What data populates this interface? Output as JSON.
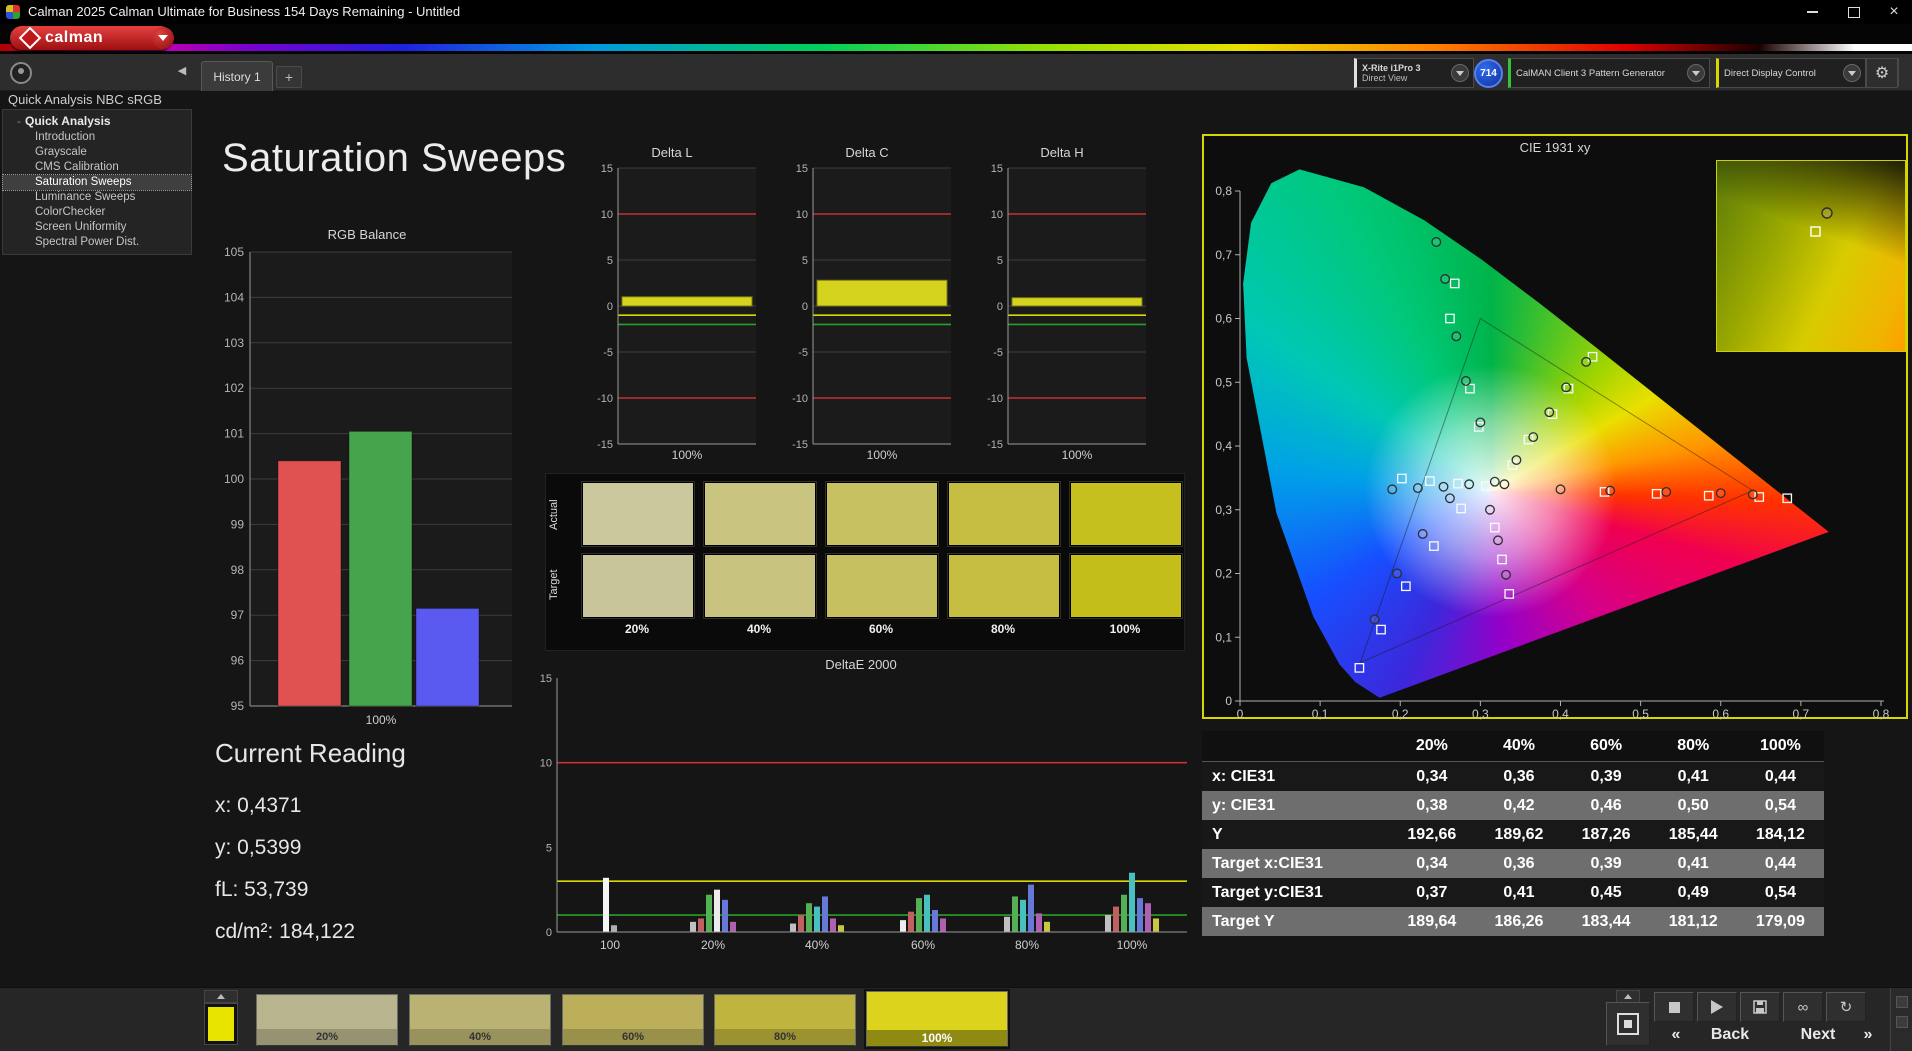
{
  "title_bar": {
    "title": "Calman 2025 Calman Ultimate for Business 154 Days Remaining  - Untitled"
  },
  "brand": {
    "logo_text": "calman"
  },
  "tab_bar": {
    "history_tab": "History 1",
    "add_tab": "+",
    "meter": {
      "line1": "X-Rite i1Pro 3",
      "line2": "Direct View"
    },
    "badge": "714",
    "pattern_generator": "CalMAN Client 3 Pattern Generator",
    "display_control": "Direct Display Control"
  },
  "sidebar": {
    "header": "Quick Analysis NBC sRGB",
    "root": "Quick Analysis",
    "items": [
      {
        "label": "Introduction",
        "selected": false
      },
      {
        "label": "Grayscale",
        "selected": false
      },
      {
        "label": "CMS Calibration",
        "selected": false
      },
      {
        "label": "Saturation Sweeps",
        "selected": true
      },
      {
        "label": "Luminance Sweeps",
        "selected": false
      },
      {
        "label": "ColorChecker",
        "selected": false
      },
      {
        "label": "Screen Uniformity",
        "selected": false
      },
      {
        "label": "Spectral Power Dist.",
        "selected": false
      }
    ]
  },
  "page": {
    "title": "Saturation Sweeps"
  },
  "current_reading": {
    "title": "Current Reading",
    "lines": [
      "x: 0,4371",
      "y: 0,5399",
      "fL: 53,739",
      "cd/m²: 184,122"
    ]
  },
  "colors": {
    "meter_stripe": "#e0e0e0",
    "source_stripe": "#35c435",
    "display_stripe": "#d8d800",
    "cie_border": "#d6d600"
  },
  "chart_data": [
    {
      "id": "rgb_balance",
      "type": "bar",
      "title": "RGB Balance",
      "categories": [
        "Red",
        "Green",
        "Blue"
      ],
      "values": [
        100.4,
        101.05,
        97.15
      ],
      "bar_colors": [
        "#e05252",
        "#46a44c",
        "#5a5af0"
      ],
      "ylim": [
        95,
        105
      ],
      "ytick_step": 1,
      "xlabel": "100%",
      "grid": true
    },
    {
      "id": "delta_l",
      "type": "bar",
      "title": "Delta L",
      "categories": [
        "100%"
      ],
      "values": [
        1.0
      ],
      "bar_color": "#d6d31f",
      "ylim": [
        -15,
        15
      ],
      "ytick_step": 5,
      "xlabel": "100%",
      "ref_lines": [
        {
          "y": 10,
          "color": "#c83232"
        },
        {
          "y": -10,
          "color": "#c83232"
        },
        {
          "y": -1,
          "color": "#d8d800"
        },
        {
          "y": -2,
          "color": "#2aa02a"
        }
      ]
    },
    {
      "id": "delta_c",
      "type": "bar",
      "title": "Delta C",
      "categories": [
        "100%"
      ],
      "values": [
        2.8
      ],
      "bar_color": "#d6d31f",
      "ylim": [
        -15,
        15
      ],
      "ytick_step": 5,
      "xlabel": "100%",
      "ref_lines": [
        {
          "y": 10,
          "color": "#c83232"
        },
        {
          "y": -10,
          "color": "#c83232"
        },
        {
          "y": -1,
          "color": "#d8d800"
        },
        {
          "y": -2,
          "color": "#2aa02a"
        }
      ]
    },
    {
      "id": "delta_h",
      "type": "bar",
      "title": "Delta H",
      "categories": [
        "100%"
      ],
      "values": [
        0.9
      ],
      "bar_color": "#d6d31f",
      "ylim": [
        -15,
        15
      ],
      "ytick_step": 5,
      "xlabel": "100%",
      "ref_lines": [
        {
          "y": 10,
          "color": "#c83232"
        },
        {
          "y": -10,
          "color": "#c83232"
        },
        {
          "y": -1,
          "color": "#d8d800"
        },
        {
          "y": -2,
          "color": "#2aa02a"
        }
      ]
    },
    {
      "id": "deltae_2000",
      "type": "grouped-bar",
      "title": "DeltaE 2000",
      "ylim": [
        0,
        15
      ],
      "ytick_step": 5,
      "ref_lines": [
        {
          "y": 10,
          "color": "#c83232"
        },
        {
          "y": 3,
          "color": "#d8d800"
        },
        {
          "y": 1,
          "color": "#2aa02a"
        }
      ],
      "groups": [
        {
          "label": "100",
          "bars": [
            {
              "color": "#f5f5f5",
              "value": 3.2
            },
            {
              "color": "#b0b0b0",
              "value": 0.4
            }
          ]
        },
        {
          "label": "20%",
          "bars": [
            {
              "color": "#c0c0c0",
              "value": 0.6
            },
            {
              "color": "#c06060",
              "value": 0.8
            },
            {
              "color": "#55b055",
              "value": 2.2
            },
            {
              "color": "#ececec",
              "value": 2.5
            },
            {
              "color": "#6678d8",
              "value": 1.9
            },
            {
              "color": "#b060b0",
              "value": 0.6
            }
          ]
        },
        {
          "label": "40%",
          "bars": [
            {
              "color": "#c0c0c0",
              "value": 0.5
            },
            {
              "color": "#c06060",
              "value": 1.0
            },
            {
              "color": "#55b055",
              "value": 1.7
            },
            {
              "color": "#48c0c0",
              "value": 1.5
            },
            {
              "color": "#6678d8",
              "value": 2.1
            },
            {
              "color": "#b060b0",
              "value": 0.8
            },
            {
              "color": "#c8c840",
              "value": 0.4
            }
          ]
        },
        {
          "label": "60%",
          "bars": [
            {
              "color": "#ececec",
              "value": 0.7
            },
            {
              "color": "#c06060",
              "value": 1.2
            },
            {
              "color": "#55b055",
              "value": 2.0
            },
            {
              "color": "#48c0c0",
              "value": 2.2
            },
            {
              "color": "#6678d8",
              "value": 1.3
            },
            {
              "color": "#b060b0",
              "value": 0.8
            }
          ]
        },
        {
          "label": "80%",
          "bars": [
            {
              "color": "#c0c0c0",
              "value": 0.9
            },
            {
              "color": "#55b055",
              "value": 2.1
            },
            {
              "color": "#48c0c0",
              "value": 1.9
            },
            {
              "color": "#6678d8",
              "value": 2.8
            },
            {
              "color": "#b060b0",
              "value": 1.1
            },
            {
              "color": "#c8c840",
              "value": 0.6
            }
          ]
        },
        {
          "label": "100%",
          "bars": [
            {
              "color": "#c0c0c0",
              "value": 1.0
            },
            {
              "color": "#c06060",
              "value": 1.5
            },
            {
              "color": "#55b055",
              "value": 2.2
            },
            {
              "color": "#48c0c0",
              "value": 3.5
            },
            {
              "color": "#6678d8",
              "value": 2.0
            },
            {
              "color": "#b060b0",
              "value": 1.7
            },
            {
              "color": "#c8c840",
              "value": 0.8
            }
          ]
        }
      ]
    },
    {
      "id": "cie_1931",
      "type": "scatter",
      "title": "CIE 1931 xy",
      "xlim": [
        0,
        0.8
      ],
      "ylim": [
        0,
        0.8
      ],
      "x_tick_labels": [
        "0",
        "0,1",
        "0,2",
        "0,3",
        "0,4",
        "0,5",
        "0,6",
        "0,7",
        "0,8"
      ],
      "y_tick_labels": [
        "0",
        "0,1",
        "0,2",
        "0,3",
        "0,4",
        "0,5",
        "0,6",
        "0,7",
        "0,8"
      ],
      "target_points": [
        [
          0.268,
          0.655
        ],
        [
          0.262,
          0.6
        ],
        [
          0.287,
          0.49
        ],
        [
          0.298,
          0.43
        ],
        [
          0.34,
          0.37
        ],
        [
          0.36,
          0.41
        ],
        [
          0.39,
          0.45
        ],
        [
          0.41,
          0.49
        ],
        [
          0.44,
          0.54
        ],
        [
          0.455,
          0.328
        ],
        [
          0.52,
          0.325
        ],
        [
          0.585,
          0.322
        ],
        [
          0.648,
          0.32
        ],
        [
          0.683,
          0.318
        ],
        [
          0.318,
          0.272
        ],
        [
          0.327,
          0.222
        ],
        [
          0.336,
          0.168
        ],
        [
          0.276,
          0.302
        ],
        [
          0.242,
          0.243
        ],
        [
          0.207,
          0.18
        ],
        [
          0.176,
          0.112
        ],
        [
          0.149,
          0.052
        ],
        [
          0.307,
          0.337
        ],
        [
          0.272,
          0.341
        ],
        [
          0.237,
          0.345
        ],
        [
          0.202,
          0.349
        ]
      ],
      "measured_points": [
        [
          0.245,
          0.72
        ],
        [
          0.256,
          0.662
        ],
        [
          0.27,
          0.572
        ],
        [
          0.282,
          0.502
        ],
        [
          0.3,
          0.437
        ],
        [
          0.345,
          0.378
        ],
        [
          0.366,
          0.414
        ],
        [
          0.386,
          0.453
        ],
        [
          0.407,
          0.492
        ],
        [
          0.432,
          0.532
        ],
        [
          0.4,
          0.332
        ],
        [
          0.462,
          0.33
        ],
        [
          0.532,
          0.328
        ],
        [
          0.6,
          0.326
        ],
        [
          0.64,
          0.324
        ],
        [
          0.312,
          0.3
        ],
        [
          0.322,
          0.252
        ],
        [
          0.332,
          0.198
        ],
        [
          0.262,
          0.318
        ],
        [
          0.228,
          0.262
        ],
        [
          0.196,
          0.2
        ],
        [
          0.168,
          0.128
        ],
        [
          0.19,
          0.332
        ],
        [
          0.222,
          0.334
        ],
        [
          0.254,
          0.336
        ],
        [
          0.286,
          0.34
        ],
        [
          0.318,
          0.344
        ],
        [
          0.33,
          0.34
        ]
      ]
    },
    {
      "id": "results_table",
      "type": "table",
      "columns": [
        "",
        "20%",
        "40%",
        "60%",
        "80%",
        "100%"
      ],
      "rows": [
        {
          "label": "x: CIE31",
          "values": [
            "0,34",
            "0,36",
            "0,39",
            "0,41",
            "0,44"
          ]
        },
        {
          "label": "y: CIE31",
          "values": [
            "0,38",
            "0,42",
            "0,46",
            "0,50",
            "0,54"
          ]
        },
        {
          "label": "Y",
          "values": [
            "192,66",
            "189,62",
            "187,26",
            "185,44",
            "184,12"
          ]
        },
        {
          "label": "Target x:CIE31",
          "values": [
            "0,34",
            "0,36",
            "0,39",
            "0,41",
            "0,44"
          ]
        },
        {
          "label": "Target y:CIE31",
          "values": [
            "0,37",
            "0,41",
            "0,45",
            "0,49",
            "0,54"
          ]
        },
        {
          "label": "Target Y",
          "values": [
            "189,64",
            "186,26",
            "183,44",
            "181,12",
            "179,09"
          ]
        }
      ]
    }
  ],
  "swatch_panel": {
    "row_labels": [
      "Actual",
      "Target"
    ],
    "columns": [
      "20%",
      "40%",
      "60%",
      "80%",
      "100%"
    ],
    "actual_colors": [
      "#c9c79b",
      "#c9c480",
      "#c7c162",
      "#c6be43",
      "#c6c01e"
    ],
    "target_colors": [
      "#c7c599",
      "#c8c37e",
      "#c6c060",
      "#c5bd41",
      "#c4be1a"
    ]
  },
  "bottom_bar": {
    "current_patch_color": "#e8e400",
    "patches": [
      {
        "label": "20%",
        "color": "#b8b48d",
        "selected": false
      },
      {
        "label": "40%",
        "color": "#bab272",
        "selected": false
      },
      {
        "label": "60%",
        "color": "#bbb059",
        "selected": false
      },
      {
        "label": "80%",
        "color": "#beb43e",
        "selected": false
      },
      {
        "label": "100%",
        "color": "#dcd41c",
        "selected": true
      }
    ],
    "back_label": "Back",
    "next_label": "Next"
  }
}
